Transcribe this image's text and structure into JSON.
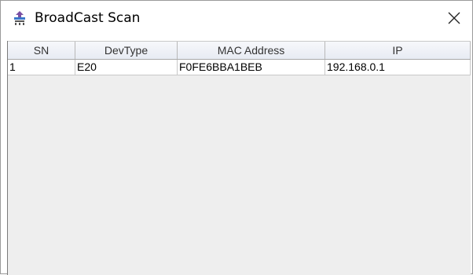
{
  "window": {
    "title": "BroadCast Scan",
    "icon": "broadcast-app-icon",
    "close_icon": "close-icon"
  },
  "table": {
    "columns": [
      "SN",
      "DevType",
      "MAC Address",
      "IP"
    ],
    "rows": [
      [
        "1",
        "E20",
        "F0FE6BBA1BEB",
        "192.168.0.1"
      ]
    ]
  },
  "colors": {
    "content_background": "#eeeeee",
    "header_background": "#eef1f7",
    "icon_purple": "#7a4fa3",
    "icon_blue": "#3a78c9"
  }
}
